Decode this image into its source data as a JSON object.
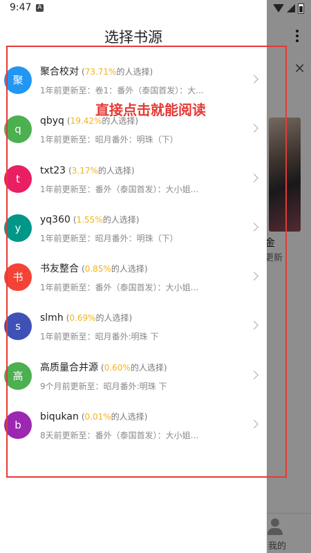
{
  "status_bar": {
    "time": "9:47",
    "notification_glyph": "A"
  },
  "drawer": {
    "title": "选择书源"
  },
  "sources": [
    {
      "avatar": "聚",
      "avatar_color": "#2196f3",
      "name": "聚合校对",
      "percent": "73.71%",
      "percent_suffix": "的人选择",
      "update": "1年前更新至：卷1：番外（泰国首发）：大..."
    },
    {
      "avatar": "q",
      "avatar_color": "#4caf50",
      "name": "qbyq",
      "percent": "19.42%",
      "percent_suffix": "的人选择",
      "update": "1年前更新至：昭月番外：明珠（下）"
    },
    {
      "avatar": "t",
      "avatar_color": "#e91e63",
      "name": "txt23",
      "percent": "3.17%",
      "percent_suffix": "的人选择",
      "update": "1年前更新至：番外（泰国首发）：大小姐..."
    },
    {
      "avatar": "y",
      "avatar_color": "#009688",
      "name": "yq360",
      "percent": "1.55%",
      "percent_suffix": "的人选择",
      "update": "1年前更新至：昭月番外：明珠（下）"
    },
    {
      "avatar": "书",
      "avatar_color": "#f44336",
      "name": "书友整合",
      "percent": "0.85%",
      "percent_suffix": "的人选择",
      "update": "1年前更新至：番外（泰国首发）：大小姐..."
    },
    {
      "avatar": "s",
      "avatar_color": "#3f51b5",
      "name": "slmh",
      "percent": "0.69%",
      "percent_suffix": "的人选择",
      "update": "1年前更新至：昭月番外:明珠 下"
    },
    {
      "avatar": "高",
      "avatar_color": "#4caf50",
      "name": "高质量合并源",
      "percent": "0.60%",
      "percent_suffix": "的人选择",
      "update": "9个月前更新至：昭月番外:明珠 下"
    },
    {
      "avatar": "b",
      "avatar_color": "#9c27b0",
      "name": "biqukan",
      "percent": "0.01%",
      "percent_suffix": "的人选择",
      "update": "8天前更新至：番外（泰国首发）：大小姐..."
    }
  ],
  "annotation": {
    "text": "直接点击就能阅读",
    "color": "#e53935"
  },
  "background": {
    "book_title_fragment": "金",
    "book_sub_fragment": "更新",
    "nav_label": "我的",
    "close_glyph": "×"
  }
}
